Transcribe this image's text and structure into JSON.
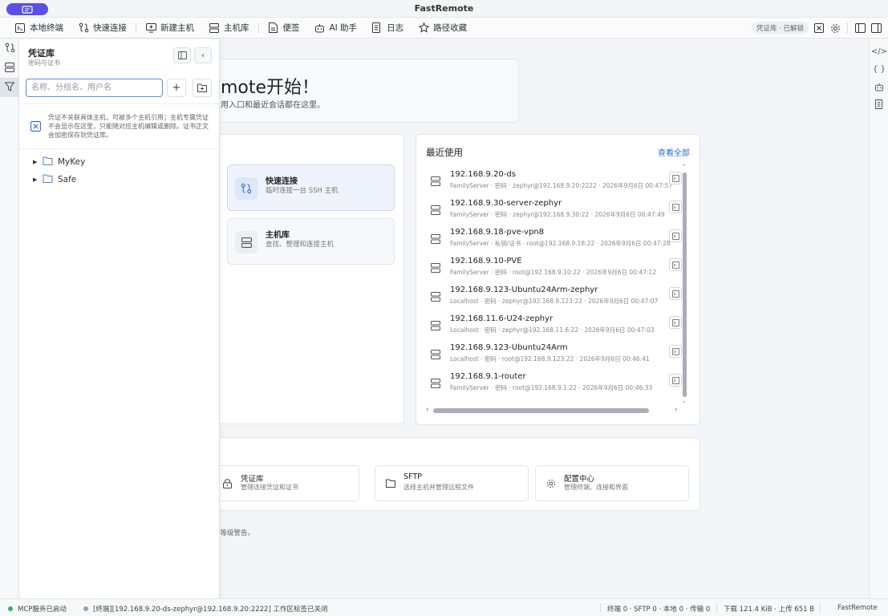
{
  "window": {
    "title": "FastRemote"
  },
  "toolbar": {
    "items": [
      {
        "label": "本地终端",
        "icon": "terminal-icon"
      },
      {
        "label": "快速连接",
        "icon": "route-icon"
      },
      {
        "label": "新建主机",
        "icon": "monitor-add-icon"
      },
      {
        "label": "主机库",
        "icon": "server-icon"
      },
      {
        "label": "便签",
        "icon": "note-icon"
      },
      {
        "label": "AI 助手",
        "icon": "robot-icon"
      },
      {
        "label": "日志",
        "icon": "log-icon"
      },
      {
        "label": "路径收藏",
        "icon": "star-icon"
      }
    ],
    "vault_badge": "凭证库 · 已解锁"
  },
  "credential_panel": {
    "title": "凭证库",
    "subtitle": "密码与证书",
    "search_placeholder": "名称、分组名、用户名",
    "add_label": "+",
    "note": "凭证不关联具体主机，可被多个主机引用；主机专属凭证不会显示在这里，只能随对应主机编辑或删除。证书正文会加密保存到凭证库。",
    "tree": [
      {
        "label": "MyKey"
      },
      {
        "label": "Safe"
      }
    ]
  },
  "welcome": {
    "title": "mote开始！",
    "subtitle": "用入口和最近会话都在这里。"
  },
  "actions": [
    {
      "title": "快速连接",
      "desc": "临时连接一台 SSH 主机"
    },
    {
      "title": "主机库",
      "desc": "查找、整理和连接主机"
    }
  ],
  "recent": {
    "title": "最近使用",
    "view_all": "查看全部",
    "rows": [
      {
        "name": "192.168.9.20-ds",
        "meta": "FamilyServer · 密码 · zephyr@192.168.9.20:2222 · 2026年9月6日 00:47:57"
      },
      {
        "name": "192.168.9.30-server-zephyr",
        "meta": "FamilyServer · 密码 · zephyr@192.168.9.30:22 · 2026年9月6日 00:47:49"
      },
      {
        "name": "192.168.9.18-pve-vpn8",
        "meta": "FamilyServer · 私钥/证书 · root@192.168.9.18:22 · 2026年9月6日 00:47:28"
      },
      {
        "name": "192.168.9.10-PVE",
        "meta": "FamilyServer · 密码 · root@192.168.9.10:22 · 2026年9月6日 00:47:12"
      },
      {
        "name": "192.168.9.123-Ubuntu24Arm-zephyr",
        "meta": "Localhost · 密码 · zephyr@192.168.9.123:22 · 2026年9月6日 00:47:07"
      },
      {
        "name": "192.168.11.6-U24-zephyr",
        "meta": "Localhost · 密码 · zephyr@192.168.11.6:22 · 2026年9月6日 00:47:03"
      },
      {
        "name": "192.168.9.123-Ubuntu24Arm",
        "meta": "Localhost · 密码 · root@192.168.9.123:22 · 2026年9月6日 00:46:41"
      },
      {
        "name": "192.168.9.1-router",
        "meta": "FamilyServer · 密码 · root@192.168.9.1:22 · 2026年9月6日 00:46:33"
      }
    ]
  },
  "shortcuts": [
    {
      "title": "凭证库",
      "desc": "管理连接凭证和证书",
      "icon": "lock-icon"
    },
    {
      "title": "SFTP",
      "desc": "选择主机并管理远程文件",
      "icon": "folder-icon"
    },
    {
      "title": "配置中心",
      "desc": "管理终端、连接和界面",
      "icon": "gear-icon"
    }
  ],
  "footer_note": "高等级警告。",
  "statusbar": {
    "mcp": "MCP服务已启动",
    "message": "[终端][192.168.9.20-ds-zephyr@192.168.9.20:2222] 工作区标签已关闭",
    "counts": "终端 0 · SFTP 0 · 本地 0 · 传输 0",
    "traffic": "下载 121.4 KiB · 上传 651 B",
    "app": "FastRemote"
  },
  "colors": {
    "accent": "#5a4fe6",
    "link": "#2f6bd6",
    "status_ok": "#2fb36b"
  }
}
